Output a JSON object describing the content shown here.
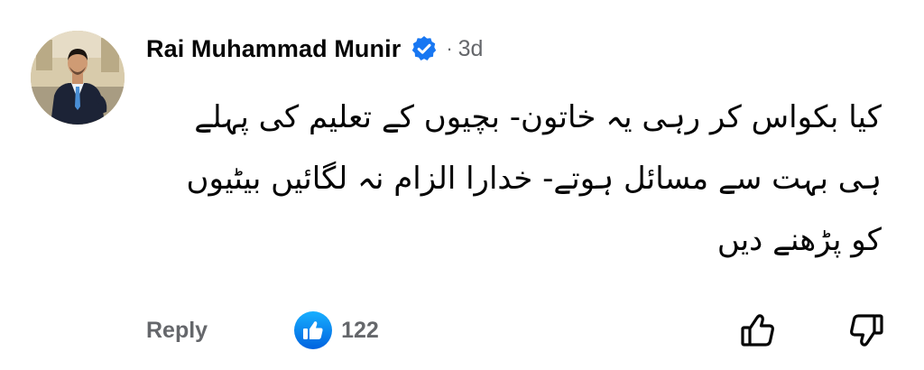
{
  "comment": {
    "author": "Rai Muhammad Munir",
    "verified_icon": "verified-badge-icon",
    "separator": "·",
    "time": "3d",
    "text": "کیا بکواس کر رہی یہ خاتون- بچیوں کے تعلیم کی پہلے ہی بہت سے مسائل ہوتے- خدارا الزام نہ لگائیں بیٹیوں کو پڑھنے دیں",
    "reply_label": "Reply",
    "reaction_icon": "like-reaction-icon",
    "reaction_count": "122",
    "upvote_icon": "thumbs-up-icon",
    "downvote_icon": "thumbs-down-icon"
  },
  "colors": {
    "accent": "#1877f2",
    "text_primary": "#050505",
    "text_secondary": "#65676b",
    "background": "#ffffff"
  }
}
